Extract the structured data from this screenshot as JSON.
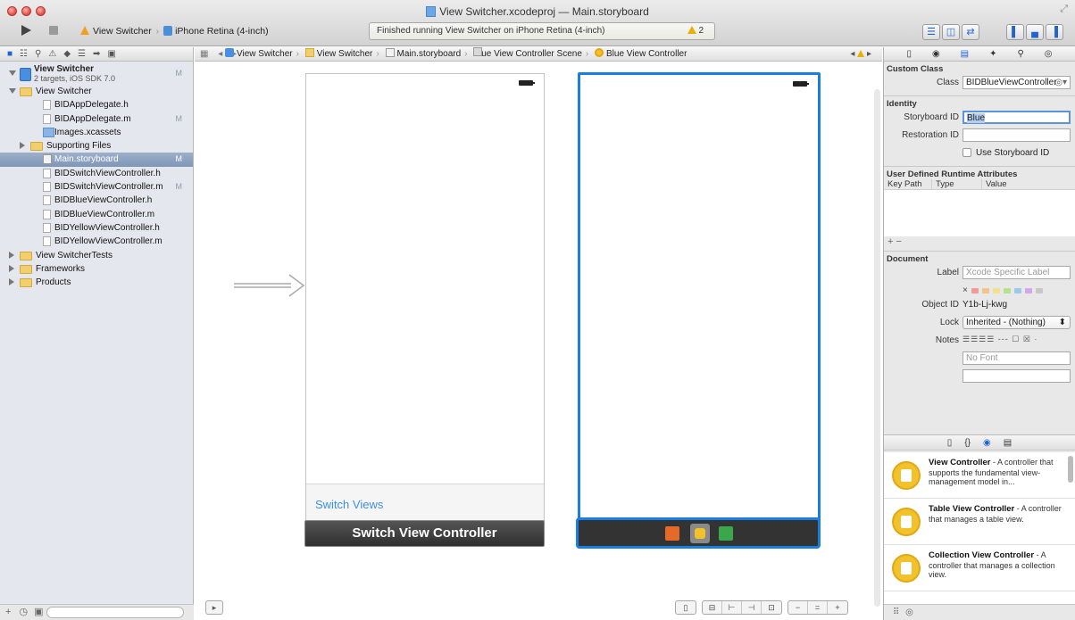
{
  "window": {
    "title": "View Switcher.xcodeproj — Main.storyboard"
  },
  "toolbar": {
    "scheme_target": "View Switcher",
    "scheme_device": "iPhone Retina (4-inch)",
    "activity_status": "Finished running View Switcher on iPhone Retina (4-inch)",
    "warning_count": "2"
  },
  "navigator": {
    "project_name": "View Switcher",
    "project_subtitle": "2 targets, iOS SDK 7.0",
    "project_badge": "M",
    "items": [
      {
        "label": "View Switcher",
        "kind": "folder",
        "level": 1,
        "disclosure": "open"
      },
      {
        "label": "BIDAppDelegate.h",
        "kind": "h",
        "level": 2
      },
      {
        "label": "BIDAppDelegate.m",
        "kind": "m",
        "level": 2,
        "badge": "M"
      },
      {
        "label": "Images.xcassets",
        "kind": "asset",
        "level": 2
      },
      {
        "label": "Supporting Files",
        "kind": "folder",
        "level": 2,
        "disclosure": "closed"
      },
      {
        "label": "Main.storyboard",
        "kind": "storyboard",
        "level": 2,
        "badge": "M",
        "selected": true
      },
      {
        "label": "BIDSwitchViewController.h",
        "kind": "h",
        "level": 2
      },
      {
        "label": "BIDSwitchViewController.m",
        "kind": "m",
        "level": 2,
        "badge": "M"
      },
      {
        "label": "BIDBlueViewController.h",
        "kind": "h",
        "level": 2
      },
      {
        "label": "BIDBlueViewController.m",
        "kind": "m",
        "level": 2
      },
      {
        "label": "BIDYellowViewController.h",
        "kind": "h",
        "level": 2
      },
      {
        "label": "BIDYellowViewController.m",
        "kind": "m",
        "level": 2
      },
      {
        "label": "View SwitcherTests",
        "kind": "folder",
        "level": 1,
        "disclosure": "closed"
      },
      {
        "label": "Frameworks",
        "kind": "folder",
        "level": 1,
        "disclosure": "closed"
      },
      {
        "label": "Products",
        "kind": "folder",
        "level": 1,
        "disclosure": "closed"
      }
    ]
  },
  "jumpbar": {
    "crumbs": [
      "View Switcher",
      "View Switcher",
      "Main.storyboard",
      "Blue View Controller Scene",
      "Blue View Controller"
    ]
  },
  "canvas": {
    "switch_views_label": "Switch Views",
    "switch_vc_dock_label": "Switch View Controller"
  },
  "inspector": {
    "custom_class_header": "Custom Class",
    "class_label": "Class",
    "class_value": "BIDBlueViewController",
    "identity_header": "Identity",
    "storyboard_id_label": "Storyboard ID",
    "storyboard_id_value": "Blue",
    "restoration_id_label": "Restoration ID",
    "use_storyboard_id_label": "Use Storyboard ID",
    "runtime_attrs_header": "User Defined Runtime Attributes",
    "col_key_path": "Key Path",
    "col_type": "Type",
    "col_value": "Value",
    "document_header": "Document",
    "label_label": "Label",
    "label_placeholder": "Xcode Specific Label",
    "object_id_label": "Object ID",
    "object_id_value": "Y1b-Lj-kwg",
    "lock_label": "Lock",
    "lock_value": "Inherited - (Nothing)",
    "notes_label": "Notes",
    "font_placeholder": "No Font"
  },
  "library": {
    "items": [
      {
        "title": "View Controller",
        "desc": " - A controller that supports the fundamental view-management model in..."
      },
      {
        "title": "Table View Controller",
        "desc": " - A controller that manages a table view."
      },
      {
        "title": "Collection View Controller",
        "desc": " - A controller that manages a collection view."
      }
    ]
  },
  "colors": {
    "selection_blue": "#1a7ee0",
    "link_blue": "#3d8ee6",
    "vc_yellow": "#f2c22a"
  }
}
